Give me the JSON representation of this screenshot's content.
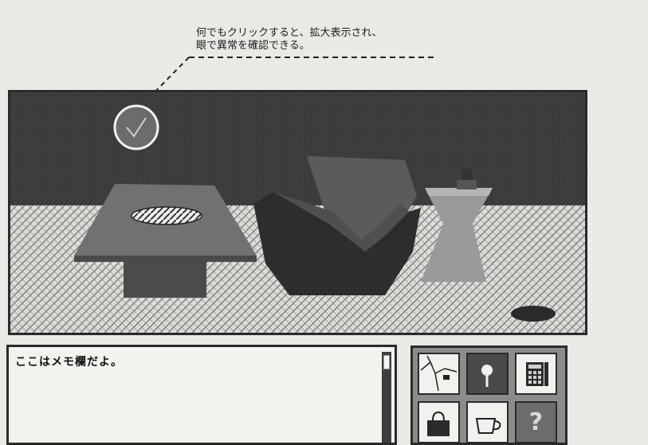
{
  "callout": {
    "line1": "何でもクリックすると、拡大表示され、",
    "line2": "眼で異常を確認できる。"
  },
  "scene": {
    "objects": [
      "check-target",
      "table",
      "sofa",
      "vase",
      "oval-rug"
    ]
  },
  "memo": {
    "text": "ここはメモ欄だよ。"
  },
  "tools": {
    "items": [
      {
        "icon": "map-icon"
      },
      {
        "icon": "magnifier-icon"
      },
      {
        "icon": "calculator-icon"
      },
      {
        "icon": "bag-icon"
      },
      {
        "icon": "cup-icon"
      },
      {
        "icon": "help-icon",
        "label": "?"
      }
    ]
  }
}
